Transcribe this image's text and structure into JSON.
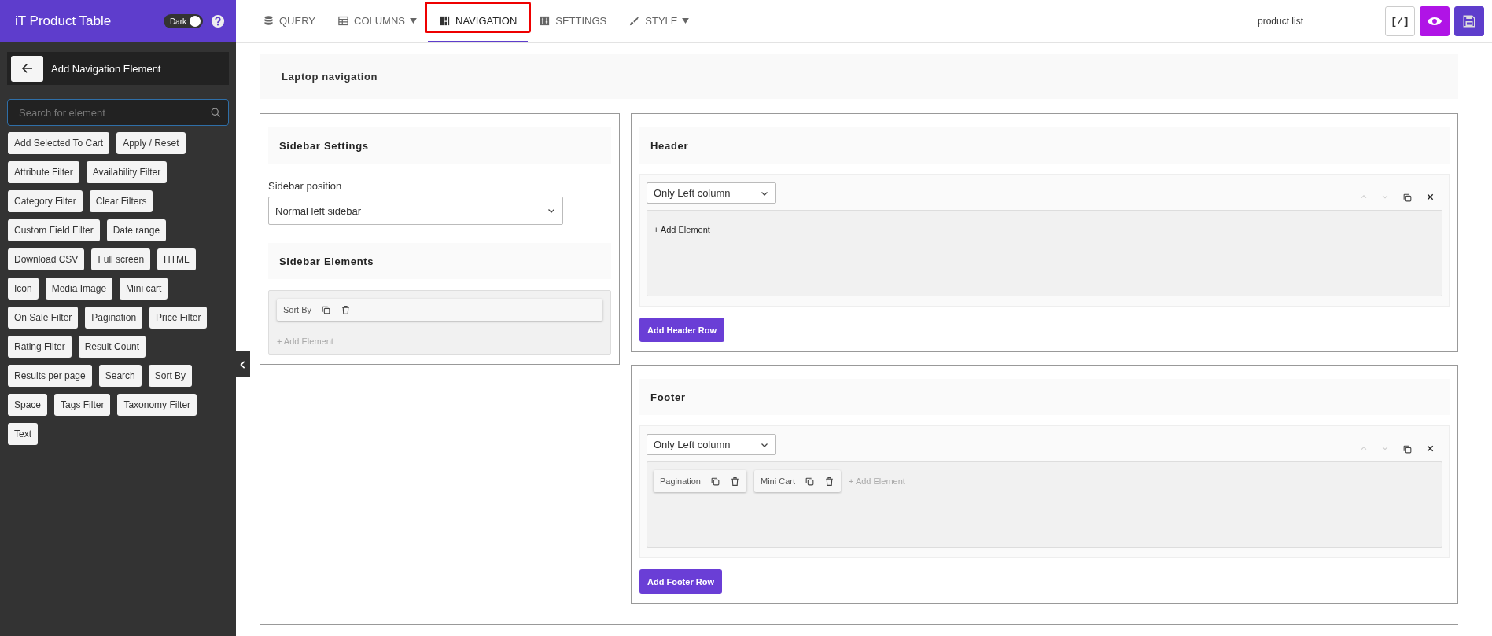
{
  "sidebar": {
    "app_title": "iT Product Table",
    "theme_toggle": {
      "label": "Dark",
      "on": true
    },
    "panel_title": "Add Navigation Element",
    "search": {
      "placeholder": "Search for element"
    },
    "elements": [
      "Add Selected To Cart",
      "Apply / Reset",
      "Attribute Filter",
      "Availability Filter",
      "Category Filter",
      "Clear Filters",
      "Custom Field Filter",
      "Date range",
      "Download CSV",
      "Full screen",
      "HTML",
      "Icon",
      "Media Image",
      "Mini cart",
      "On Sale Filter",
      "Pagination",
      "Price Filter",
      "Rating Filter",
      "Result Count",
      "Results per page",
      "Search",
      "Sort By",
      "Space",
      "Tags Filter",
      "Taxonomy Filter",
      "Text"
    ]
  },
  "tabs": [
    {
      "label": "QUERY",
      "selected": false,
      "has_menu": false,
      "highlighted": false
    },
    {
      "label": "COLUMNS",
      "selected": false,
      "has_menu": true,
      "highlighted": false
    },
    {
      "label": "NAVIGATION",
      "selected": true,
      "has_menu": false,
      "highlighted": true
    },
    {
      "label": "SETTINGS",
      "selected": false,
      "has_menu": false,
      "highlighted": false
    },
    {
      "label": "STYLE",
      "selected": false,
      "has_menu": true,
      "highlighted": false
    }
  ],
  "table_name": "product list",
  "shortcode_button": "[/]",
  "layout": {
    "title": "Laptop navigation"
  },
  "sidebar_settings": {
    "title": "Sidebar Settings",
    "position_label": "Sidebar position",
    "position_value": "Normal left sidebar",
    "elements_title": "Sidebar Elements",
    "items": [
      {
        "label": "Sort By"
      }
    ],
    "add_label": "+ Add Element"
  },
  "sections": [
    {
      "title": "Header",
      "rows": [
        {
          "columns": "Only Left column",
          "items": [],
          "add_label": "+ Add Element",
          "add_dimmed": false
        }
      ],
      "add_row_button": "Add Header Row"
    },
    {
      "title": "Footer",
      "rows": [
        {
          "columns": "Only Left column",
          "items": [
            {
              "label": "Pagination"
            },
            {
              "label": "Mini Cart"
            }
          ],
          "add_label": "+ Add Element",
          "add_dimmed": true
        }
      ],
      "add_row_button": "Add Footer Row"
    }
  ]
}
